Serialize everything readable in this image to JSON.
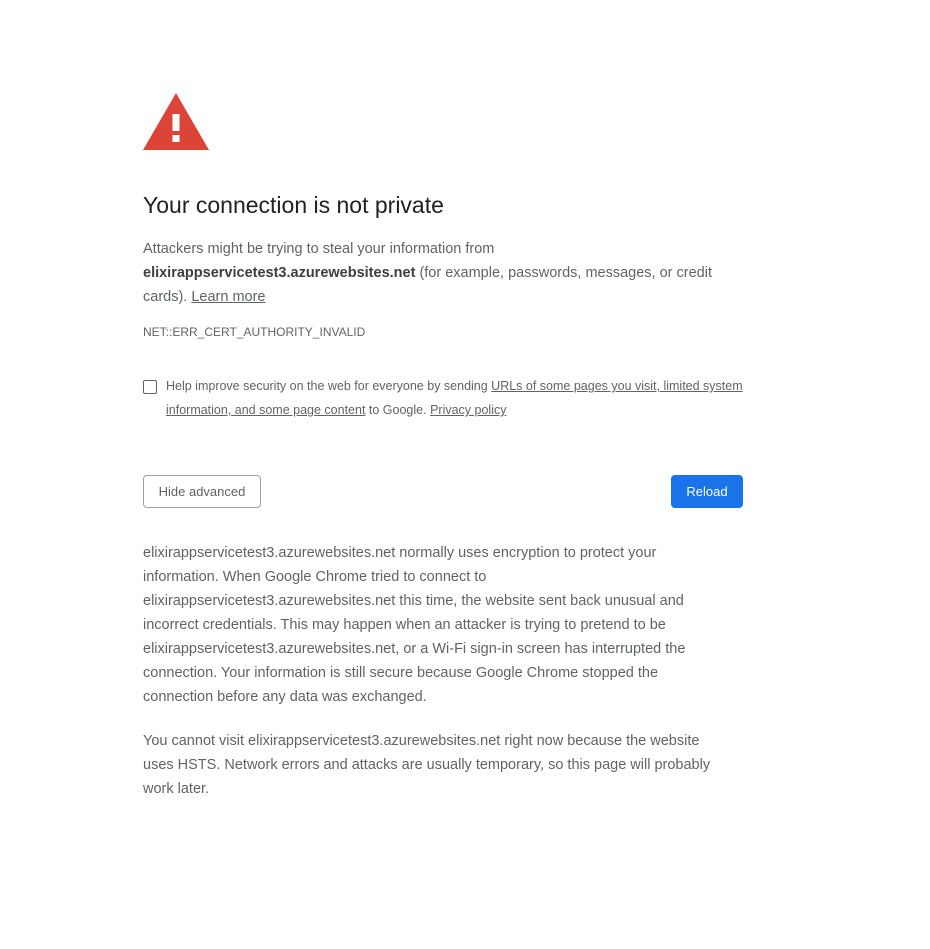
{
  "page": {
    "title": "Your connection is not private",
    "intro": {
      "prefix": "Attackers might be trying to steal your information from ",
      "domain": "elixirappservicetest3.azurewebsites.net",
      "suffix": " (for example, passwords, messages, or credit cards). ",
      "learn_more": "Learn more"
    },
    "error_code": "NET::ERR_CERT_AUTHORITY_INVALID",
    "optin": {
      "prefix": "Help improve security on the web for everyone by sending ",
      "link1": "URLs of some pages you visit, limited system information, and some page content",
      "middle": " to Google. ",
      "link2": "Privacy policy",
      "checked": false
    },
    "buttons": {
      "hide_advanced": "Hide advanced",
      "reload": "Reload"
    },
    "details": {
      "paragraph1": "elixirappservicetest3.azurewebsites.net normally uses encryption to protect your information. When Google Chrome tried to connect to elixirappservicetest3.azurewebsites.net this time, the website sent back unusual and incorrect credentials. This may happen when an attacker is trying to pretend to be elixirappservicetest3.azurewebsites.net, or a Wi-Fi sign-in screen has interrupted the connection. Your information is still secure because Google Chrome stopped the connection before any data was exchanged.",
      "paragraph2": "You cannot visit elixirappservicetest3.azurewebsites.net right now because the website uses HSTS. Network errors and attacks are usually temporary, so this page will probably work later."
    }
  },
  "icons": {
    "warning": "warning-triangle-icon"
  },
  "colors": {
    "warning_red": "#db4437",
    "primary_blue": "#1a73e8",
    "text_secondary": "#5f6368",
    "text_primary": "#202124"
  }
}
